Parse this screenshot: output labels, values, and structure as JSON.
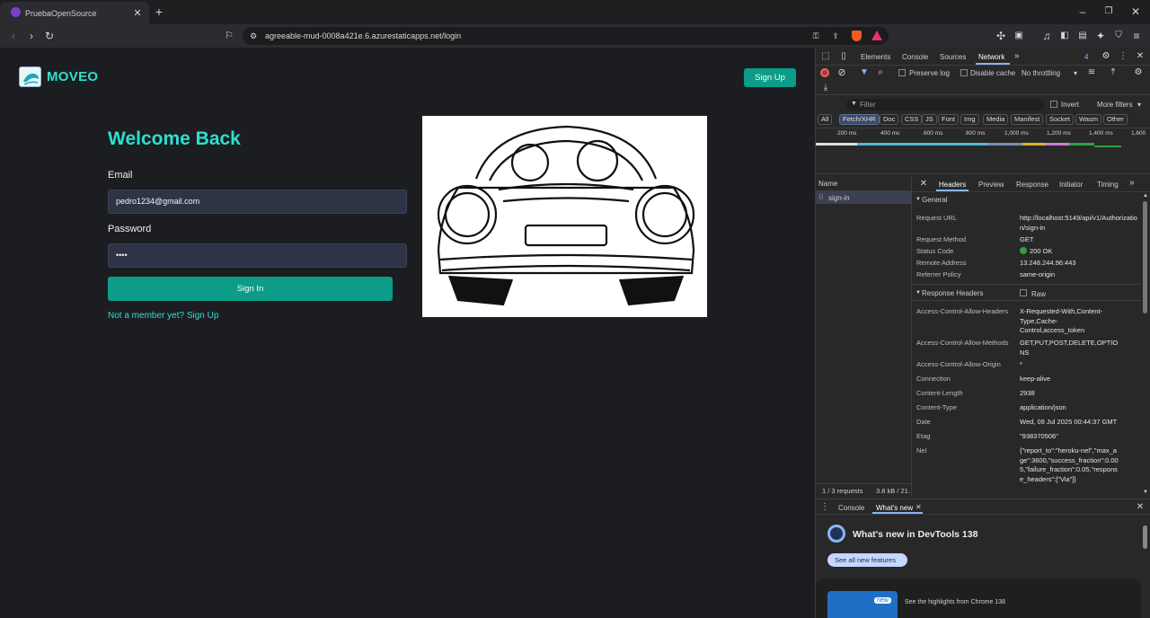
{
  "browser": {
    "tab_title": "PruebaOpenSource",
    "new_tab": "+",
    "url": "agreeable-mud-0008a421e.6.azurestaticapps.net/login"
  },
  "app": {
    "brand": "MOVEO",
    "signup_top": "Sign Up",
    "welcome": "Welcome Back",
    "email_label": "Email",
    "email_value": "pedro1234@gmail.com",
    "password_label": "Password",
    "password_value": "••••",
    "signin": "Sign In",
    "not_member": "Not a member yet? Sign Up"
  },
  "devtools": {
    "tabs": [
      "Elements",
      "Console",
      "Sources",
      "Network"
    ],
    "badge": "4",
    "preserve_log": "Preserve log",
    "disable_cache": "Disable cache",
    "throttling": "No throttling",
    "filter_placeholder": "Filter",
    "invert": "Invert",
    "more_filters": "More filters",
    "type_filters": [
      "All",
      "Fetch/XHR",
      "Doc",
      "CSS",
      "JS",
      "Font",
      "Img",
      "Media",
      "Manifest",
      "Socket",
      "Wasm",
      "Other"
    ],
    "timeline_ticks": [
      "200 ms",
      "400 ms",
      "600 ms",
      "800 ms",
      "1,000 ms",
      "1,200 ms",
      "1,400 ms",
      "1,600"
    ],
    "name_header": "Name",
    "request_name": "sign-in",
    "detail_tabs": [
      "Headers",
      "Preview",
      "Response",
      "Initiator",
      "Timing"
    ],
    "general_title": "General",
    "general": [
      {
        "k": "Request URL",
        "v": "http://localhost:5149/api/v1/Authorization/sign-in"
      },
      {
        "k": "Request Method",
        "v": "GET"
      },
      {
        "k": "Status Code",
        "v": "200 OK"
      },
      {
        "k": "Remote Address",
        "v": "13.248.244.96:443"
      },
      {
        "k": "Referrer Policy",
        "v": "same-origin"
      }
    ],
    "response_title": "Response Headers",
    "raw": "Raw",
    "response": [
      {
        "k": "Access-Control-Allow-Headers",
        "v": "X-Requested-With,Content-Type,Cache-Control,access_token"
      },
      {
        "k": "Access-Control-Allow-Methods",
        "v": "GET,PUT,POST,DELETE,OPTIONS"
      },
      {
        "k": "Access-Control-Allow-Origin",
        "v": "*"
      },
      {
        "k": "Connection",
        "v": "keep-alive"
      },
      {
        "k": "Content-Length",
        "v": "2938"
      },
      {
        "k": "Content-Type",
        "v": "application/json"
      },
      {
        "k": "Date",
        "v": "Wed, 09 Jul 2025 00:44:37 GMT"
      },
      {
        "k": "Etag",
        "v": "\"938370506\""
      },
      {
        "k": "Nel",
        "v": "{\"report_to\":\"heroku-nel\",\"max_age\":3600,\"success_fraction\":0.005,\"failure_fraction\":0.05,\"response_headers\":[\"Via\"]}"
      }
    ],
    "summary_requests": "1 / 3 requests",
    "summary_size": "3.8 kB / 21.",
    "drawer_console": "Console",
    "drawer_whatsnew": "What's new",
    "whatsnew_title": "What's new in DevTools 138",
    "see_all": "See all new features",
    "new_badge": "new",
    "highlights": "See the highlights from Chrome 138"
  }
}
